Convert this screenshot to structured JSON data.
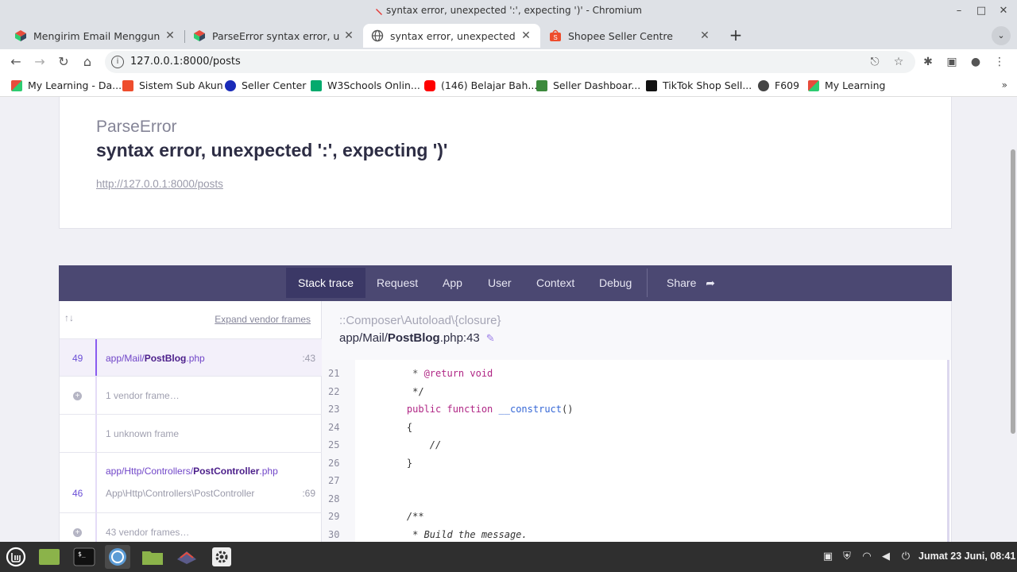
{
  "window": {
    "title": "syntax error, unexpected ':', expecting ')' - Chromium",
    "minimize_glyph": "–",
    "maximize_glyph": "□",
    "close_glyph": "✕"
  },
  "tabs": [
    {
      "label": "Mengirim Email Menggunakan",
      "active": false
    },
    {
      "label": "ParseError syntax error, unexp",
      "active": false
    },
    {
      "label": "syntax error, unexpected ':', e",
      "active": true
    },
    {
      "label": "Shopee Seller Centre",
      "active": false
    }
  ],
  "tab_close_glyph": "✕",
  "new_tab_glyph": "+",
  "tab_search_glyph": "⌄",
  "toolbar": {
    "back_glyph": "←",
    "forward_glyph": "→",
    "reload_glyph": "↻",
    "home_glyph": "⌂",
    "url": "127.0.0.1:8000/posts",
    "info_glyph": "i",
    "share_glyph": "⎋",
    "star_glyph": "☆",
    "extensions_glyph": "✱",
    "sidepanel_glyph": "▣",
    "profile_glyph": "●",
    "menu_glyph": "⋮"
  },
  "bookmarks": [
    {
      "label": "My Learning - Da...",
      "color": "#c0392b"
    },
    {
      "label": "Sistem Sub Akun",
      "color": "#ee4d2d"
    },
    {
      "label": "Seller Center",
      "color": "#1a2bb8"
    },
    {
      "label": "W3Schools Onlin...",
      "color": "#04aa6d"
    },
    {
      "label": "(146) Belajar Bah...",
      "color": "#ff0000"
    },
    {
      "label": "Seller Dashboar...",
      "color": "#3c8a3c"
    },
    {
      "label": "TikTok Shop Sell...",
      "color": "#111111"
    },
    {
      "label": "F609",
      "color": "#444444"
    },
    {
      "label": "My Learning",
      "color": "#c0392b"
    }
  ],
  "bookmarks_more": "»",
  "error": {
    "class": "ParseError",
    "message": "syntax error, unexpected ':', expecting ')'",
    "url": "http://127.0.0.1:8000/posts"
  },
  "nav": {
    "items": [
      "Stack trace",
      "Request",
      "App",
      "User",
      "Context",
      "Debug"
    ],
    "share_label": "Share",
    "share_glyph": "➦"
  },
  "stack": {
    "arrows": "↑↓",
    "expand_label": "Expand vendor frames",
    "frames": [
      {
        "type": "app",
        "num": "49",
        "path_prefix": "app/Mail/",
        "path_bold": "PostBlog",
        "path_suffix": ".php",
        "line": ":43",
        "sub": "",
        "selected": true
      },
      {
        "type": "vendor",
        "label": "1 vendor frame…"
      },
      {
        "type": "unknown",
        "label": "1 unknown frame"
      },
      {
        "type": "app",
        "num": "46",
        "path_prefix": "app/Http/Controllers/",
        "path_bold": "PostController",
        "path_suffix": ".php",
        "line": ":69",
        "sub": "App\\Http\\Controllers\\PostController",
        "selected": false
      },
      {
        "type": "vendor",
        "label": "43 vendor frames…"
      }
    ],
    "plus_glyph": "+"
  },
  "code": {
    "class": "::Composer\\Autoload\\{closure}",
    "file_prefix": "app/Mail/",
    "file_bold": "PostBlog",
    "file_suffix": ".php:43",
    "pencil_glyph": "✎",
    "lines": [
      {
        "n": "21",
        "text": "     * @return void"
      },
      {
        "n": "22",
        "text": "     */"
      },
      {
        "n": "23",
        "text": "    public function __construct()"
      },
      {
        "n": "24",
        "text": "    {"
      },
      {
        "n": "25",
        "text": "        //"
      },
      {
        "n": "26",
        "text": "    }"
      },
      {
        "n": "27",
        "text": ""
      },
      {
        "n": "28",
        "text": ""
      },
      {
        "n": "29",
        "text": "    /**"
      },
      {
        "n": "30",
        "text": "     * Build the message."
      }
    ]
  },
  "taskbar": {
    "clock": "Jumat 23 Juni, 08:41",
    "tray_icons": [
      "clipboard-icon",
      "shield-icon",
      "wifi-icon",
      "volume-icon",
      "power-icon"
    ]
  }
}
